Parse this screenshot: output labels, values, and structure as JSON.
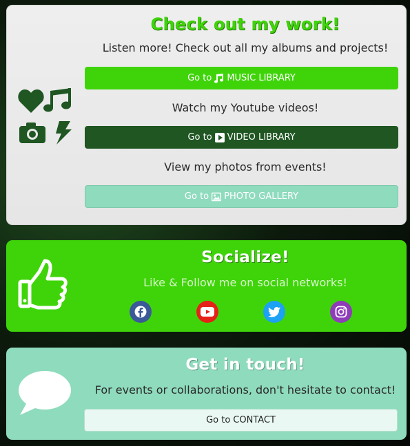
{
  "work": {
    "title": "Check out my work!",
    "music_text": "Listen more! Check out all my albums and projects!",
    "music_btn_prefix": "Go to",
    "music_btn_label": "MUSIC LIBRARY",
    "video_text": "Watch my Youtube videos!",
    "video_btn_prefix": "Go to",
    "video_btn_label": "VIDEO LIBRARY",
    "photo_text": "View my photos from events!",
    "photo_btn_prefix": "Go to",
    "photo_btn_label": "PHOTO GALLERY",
    "icons": [
      "heart-icon",
      "music-notes-icon",
      "camera-icon",
      "lightning-icon"
    ],
    "icon_color": "#1f5622"
  },
  "social": {
    "title": "Socialize!",
    "text": "Like & Follow me on social networks!",
    "networks": [
      {
        "name": "facebook",
        "color": "#3b5998"
      },
      {
        "name": "youtube",
        "color": "#e62117"
      },
      {
        "name": "twitter",
        "color": "#1da1f2"
      },
      {
        "name": "instagram",
        "color": "#8e3cb8"
      }
    ]
  },
  "contact": {
    "title": "Get in touch!",
    "text": "For events or collaborations, don't hesitate to contact!",
    "btn_prefix": "Go to",
    "btn_label": "CONTACT"
  },
  "colors": {
    "accent_green": "#3fd40a",
    "dark_green": "#1f5622",
    "mint": "#8fdbbd"
  }
}
